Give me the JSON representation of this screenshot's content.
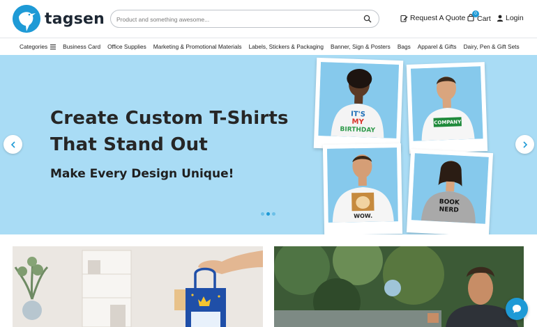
{
  "header": {
    "brand": "tagsen",
    "search_placeholder": "Product and something awesome...",
    "quote_label": "Request A Quote",
    "cart_label": "Cart",
    "cart_count": "0",
    "login_label": "Login"
  },
  "nav": {
    "items": [
      "Categories",
      "Business Card",
      "Office Supplies",
      "Marketing & Promotional Materials",
      "Labels, Stickers & Packaging",
      "Banner, Sign & Posters",
      "Bags",
      "Apparel & Gifts",
      "Dairy, Pen & Gift Sets"
    ]
  },
  "hero": {
    "title_line1": "Create Custom T-Shirts",
    "title_line2": "That Stand Out",
    "subtitle": "Make Every Design Unique!",
    "shirt_texts": {
      "birthday": [
        "IT'S",
        "MY",
        "BIRTHDAY"
      ],
      "company": "COMPANY",
      "wow": "WOW.",
      "book_nerd": [
        "BOOK",
        "NERD"
      ]
    },
    "slides_total": 3,
    "slide_active": 2
  },
  "colors": {
    "brand": "#1e9ad6",
    "hero_bg": "#a9dcf5",
    "text_dark": "#262626"
  },
  "icons": {
    "search": "search-icon",
    "quote": "edit-document-icon",
    "cart": "shopping-bag-icon",
    "login": "user-icon",
    "menu": "hamburger-icon",
    "prev": "chevron-left-icon",
    "next": "chevron-right-icon",
    "chat": "chat-bubble-icon"
  }
}
